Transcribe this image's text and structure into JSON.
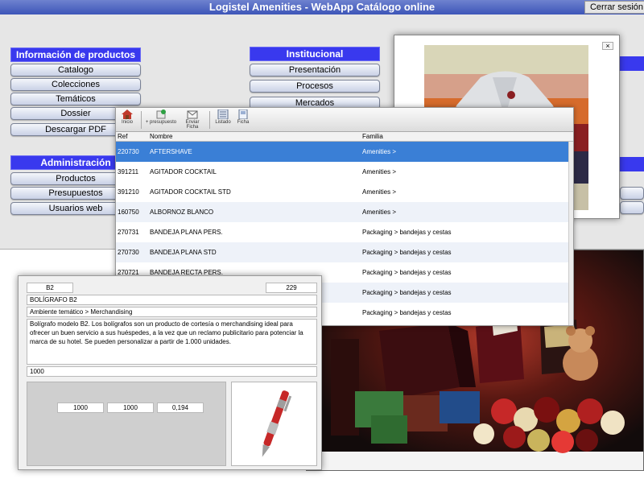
{
  "header": {
    "title": "Logistel Amenities - WebApp Catálogo online",
    "logout_label": "Cerrar sesión"
  },
  "sections": {
    "productos": {
      "title": "Información de productos",
      "items": [
        "Catalogo",
        "Colecciones",
        "Temáticos",
        "Dossier",
        "Descargar PDF"
      ]
    },
    "admin": {
      "title": "Administración",
      "items": [
        "Productos",
        "Presupuestos",
        "Usuarios web"
      ]
    },
    "institucional": {
      "title": "Institucional",
      "items": [
        "Presentación",
        "Procesos",
        "Mercados"
      ]
    }
  },
  "toolbar": {
    "items": [
      "Inicio",
      "+ presupuesto",
      "Enviar Ficha",
      "Listado",
      "Ficha"
    ]
  },
  "table": {
    "columns": [
      "Ref",
      "Nombre",
      "Familia"
    ],
    "rows": [
      {
        "ref": "220730",
        "name": "AFTERSHAVE",
        "family": "Amenities >"
      },
      {
        "ref": "391211",
        "name": "AGITADOR COCKTAIL",
        "family": "Amenities >"
      },
      {
        "ref": "391210",
        "name": "AGITADOR COCKTAIL STD",
        "family": "Amenities >"
      },
      {
        "ref": "160750",
        "name": "ALBORNOZ BLANCO",
        "family": "Amenities >"
      },
      {
        "ref": "270731",
        "name": "BANDEJA PLANA PERS.",
        "family": "Packaging > bandejas y cestas"
      },
      {
        "ref": "270730",
        "name": "BANDEJA PLANA STD",
        "family": "Packaging > bandejas y cestas"
      },
      {
        "ref": "270721",
        "name": "BANDEJA RECTA PERS.",
        "family": "Packaging > bandejas y cestas"
      },
      {
        "ref": "",
        "name": "",
        "family": "Packaging > bandejas y cestas"
      },
      {
        "ref": "",
        "name": "",
        "family": "Packaging > bandejas y cestas"
      }
    ]
  },
  "photo": {
    "close_label": "×"
  },
  "detail": {
    "code": "B2",
    "number": "229",
    "name": "BOLÍGRAFO B2",
    "category": "Ambiente temático > Merchandising",
    "description": "Bolígrafo modelo B2. Los bolígrafos son un producto de cortesía o merchandising ideal para ofrecer un buen servicio a sus huéspedes, a la vez que un reclamo publicitario para potenciar la marca de su hotel. Se pueden personalizar a partir de 1.000 unidades.",
    "min_qty": "1000",
    "values": [
      "1000",
      "1000",
      "0,194"
    ]
  },
  "colors": {
    "accent": "#3939ee",
    "selection": "#3a7fd6",
    "titlebar": "#3d55b8"
  }
}
